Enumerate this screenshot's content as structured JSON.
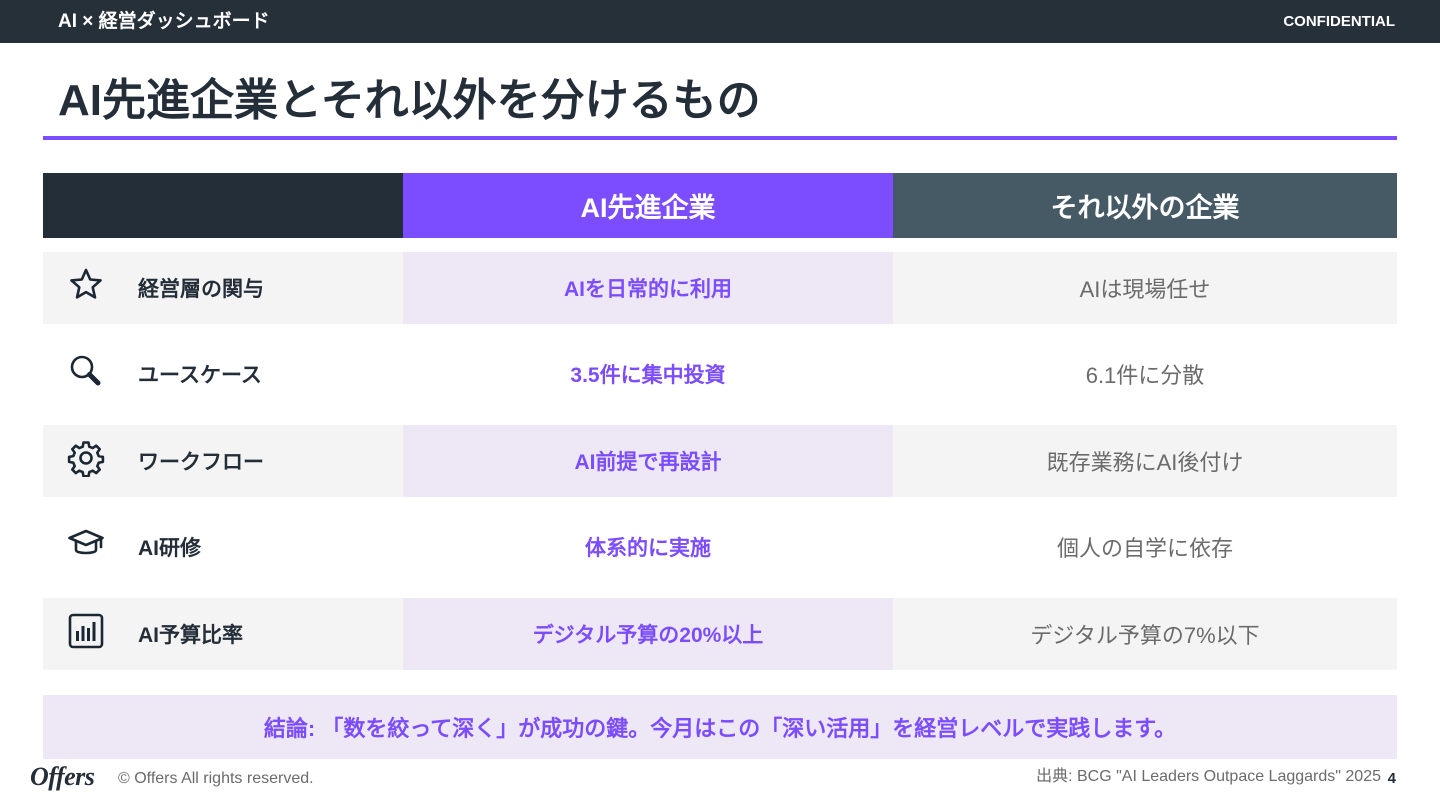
{
  "header": {
    "brand": "AI × 経営ダッシュボード",
    "confidential": "CONFIDENTIAL"
  },
  "title": "AI先進企業とそれ以外を分けるもの",
  "table": {
    "columns": [
      "",
      "AI先進企業",
      "それ以外の企業"
    ],
    "rows": [
      {
        "icon": "star-icon",
        "label": "経営層の関与",
        "advanced": "AIを日常的に利用",
        "others": "AIは現場任せ"
      },
      {
        "icon": "magnifier-icon",
        "label": "ユースケース",
        "advanced": "3.5件に集中投資",
        "others": "6.1件に分散"
      },
      {
        "icon": "gear-icon",
        "label": "ワークフロー",
        "advanced": "AI前提で再設計",
        "others": "既存業務にAI後付け"
      },
      {
        "icon": "graduation-cap-icon",
        "label": "AI研修",
        "advanced": "体系的に実施",
        "others": "個人の自学に依存"
      },
      {
        "icon": "bar-chart-icon",
        "label": "AI予算比率",
        "advanced": "デジタル予算の20%以上",
        "others": "デジタル予算の7%以下"
      }
    ]
  },
  "conclusion": "結論: 「数を絞って深く」が成功の鍵。今月はこの「深い活用」を経営レベルで実践します。",
  "footer": {
    "logo": "Offers",
    "copyright": "© Offers All rights reserved.",
    "source": "出典: BCG \"AI Leaders Outpace Laggards\" 2025",
    "page": "4"
  },
  "colors": {
    "accent": "#7c4dff",
    "dark": "#232e38",
    "slate": "#455a64",
    "tint": "#ede7f6",
    "row_shade": "#f4f4f4"
  }
}
